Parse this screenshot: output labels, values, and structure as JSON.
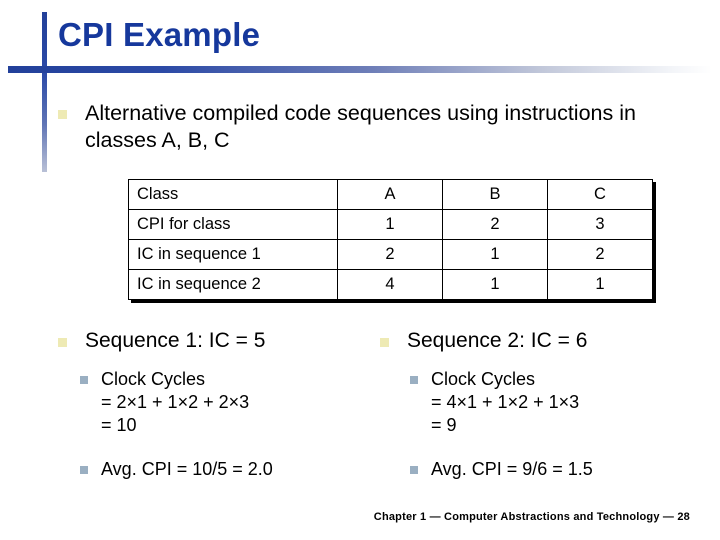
{
  "slide": {
    "title": "CPI Example",
    "title_color": "#16389c",
    "rule_color": "#22409a",
    "bullet_lvl1_color": "#eeeab4",
    "bullet_lvl2_color": "#9aafc2"
  },
  "intro": {
    "text": "Alternative compiled code sequences using instructions in classes A, B, C"
  },
  "table": {
    "rows": [
      {
        "label": "Class",
        "a": "A",
        "b": "B",
        "c": "C"
      },
      {
        "label": "CPI for class",
        "a": "1",
        "b": "2",
        "c": "3"
      },
      {
        "label": "IC in sequence 1",
        "a": "2",
        "b": "1",
        "c": "2"
      },
      {
        "label": "IC in sequence 2",
        "a": "4",
        "b": "1",
        "c": "1"
      }
    ]
  },
  "sequences": [
    {
      "heading": "Sequence 1: IC = 5",
      "clock_cycles": {
        "title": "Clock Cycles",
        "expression": "= 2×1 + 1×2 + 2×3",
        "total": "= 10"
      },
      "avg_cpi": "Avg. CPI = 10/5 = 2.0"
    },
    {
      "heading": "Sequence 2: IC = 6",
      "clock_cycles": {
        "title": "Clock Cycles",
        "expression": "= 4×1 + 1×2 + 1×3",
        "total": "= 9"
      },
      "avg_cpi": "Avg. CPI = 9/6 = 1.5"
    }
  ],
  "footer": {
    "text": "Chapter 1 — Computer Abstractions and Technology — 28"
  }
}
